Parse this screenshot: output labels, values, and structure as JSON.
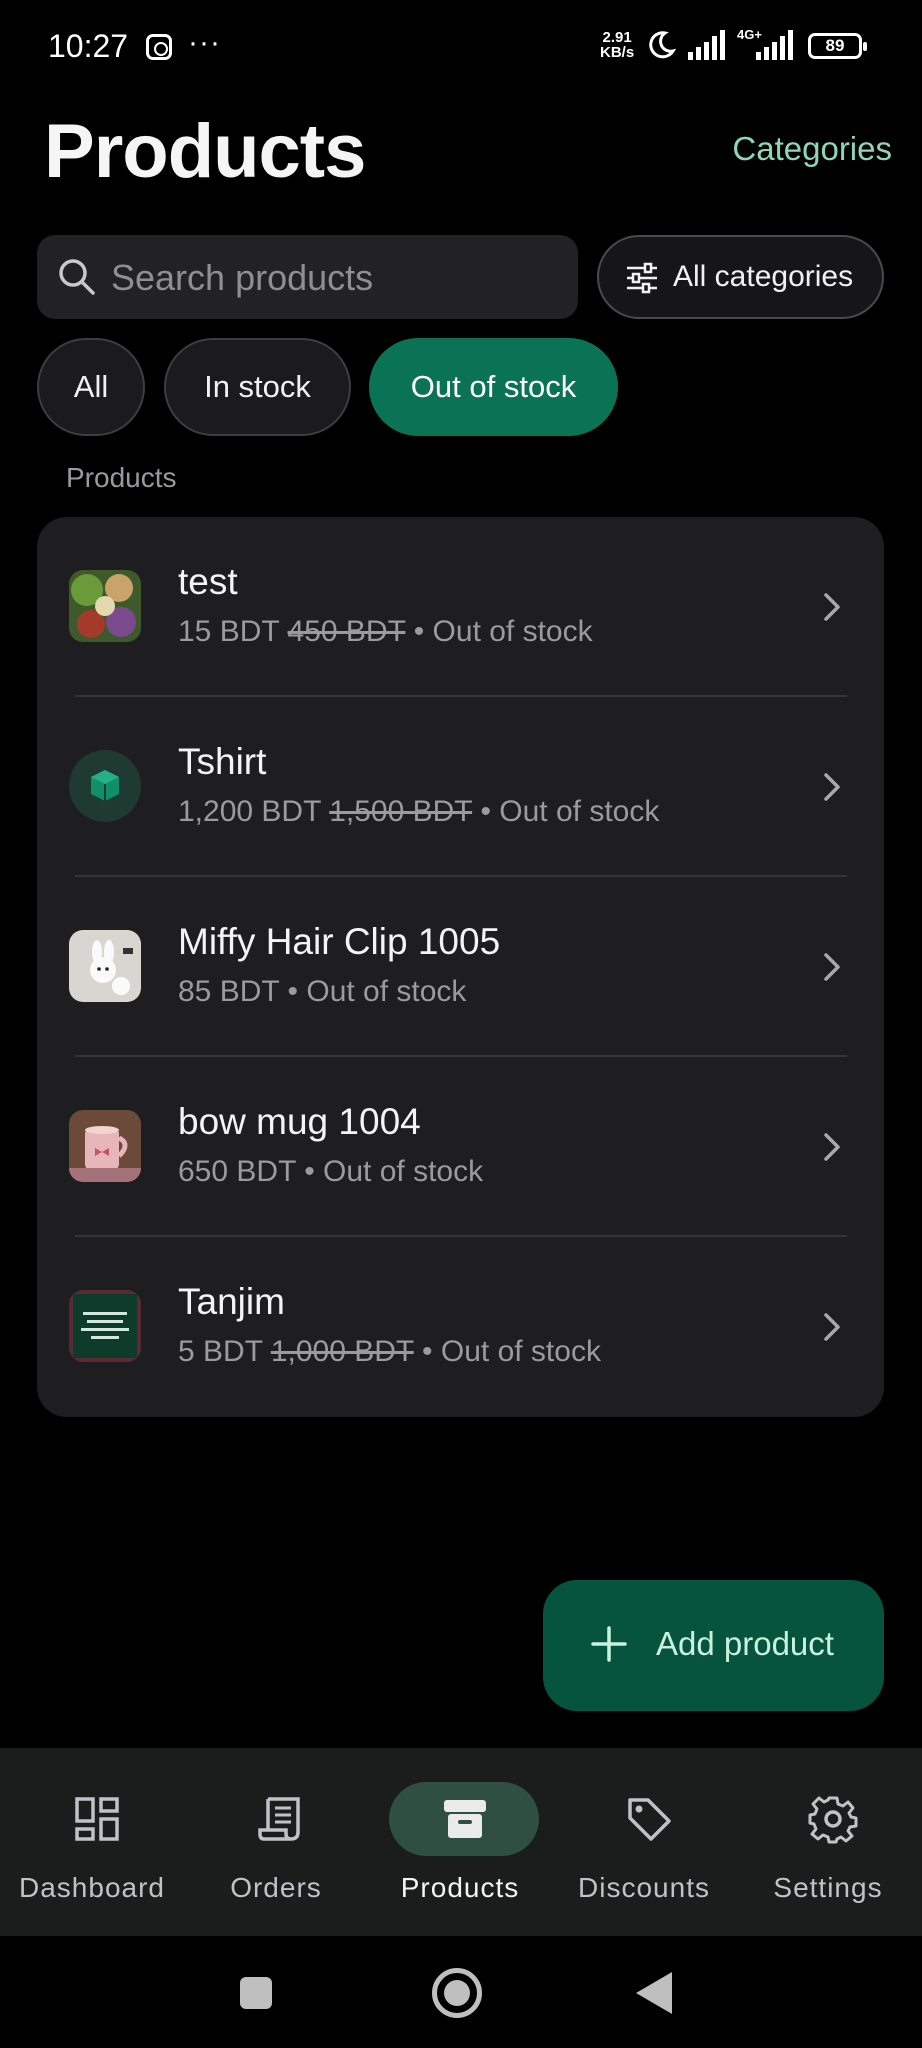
{
  "status_bar": {
    "time": "10:27",
    "more": "···",
    "speed_value": "2.91",
    "speed_unit": "KB/s",
    "network": "4G+",
    "battery": "89"
  },
  "header": {
    "title": "Products",
    "categories_link": "Categories"
  },
  "search": {
    "placeholder": "Search products"
  },
  "filter": {
    "label": "All categories"
  },
  "chips": [
    {
      "label": "All",
      "active": false
    },
    {
      "label": "In stock",
      "active": false
    },
    {
      "label": "Out of stock",
      "active": true
    }
  ],
  "section_label": "Products",
  "products": [
    {
      "name": "test",
      "price": "15 BDT",
      "old_price": "450 BDT",
      "status": "• Out of stock",
      "thumb": "salad-photo"
    },
    {
      "name": "Tshirt",
      "price": "1,200 BDT",
      "old_price": "1,500 BDT",
      "status": "• Out of stock",
      "thumb": "box-placeholder"
    },
    {
      "name": "Miffy Hair Clip 1005",
      "price": "85 BDT",
      "old_price": "",
      "status": "• Out of stock",
      "thumb": "miffy-photo"
    },
    {
      "name": "bow mug 1004",
      "price": "650 BDT",
      "old_price": "",
      "status": "• Out of stock",
      "thumb": "mug-photo"
    },
    {
      "name": "Tanjim",
      "price": "5 BDT",
      "old_price": "1,000 BDT",
      "status": "• Out of stock",
      "thumb": "green-card-photo"
    }
  ],
  "fab": {
    "label": "Add product"
  },
  "bottom_nav": [
    {
      "label": "Dashboard",
      "icon": "dashboard-icon",
      "active": false
    },
    {
      "label": "Orders",
      "icon": "receipt-icon",
      "active": false
    },
    {
      "label": "Products",
      "icon": "archive-icon",
      "active": true
    },
    {
      "label": "Discounts",
      "icon": "tag-icon",
      "active": false
    },
    {
      "label": "Settings",
      "icon": "gear-icon",
      "active": false
    }
  ],
  "colors": {
    "accent": "#0a7356",
    "accent_text": "#8fd6b4",
    "fab_bg": "#06533e",
    "card_bg": "#1e1e20"
  }
}
